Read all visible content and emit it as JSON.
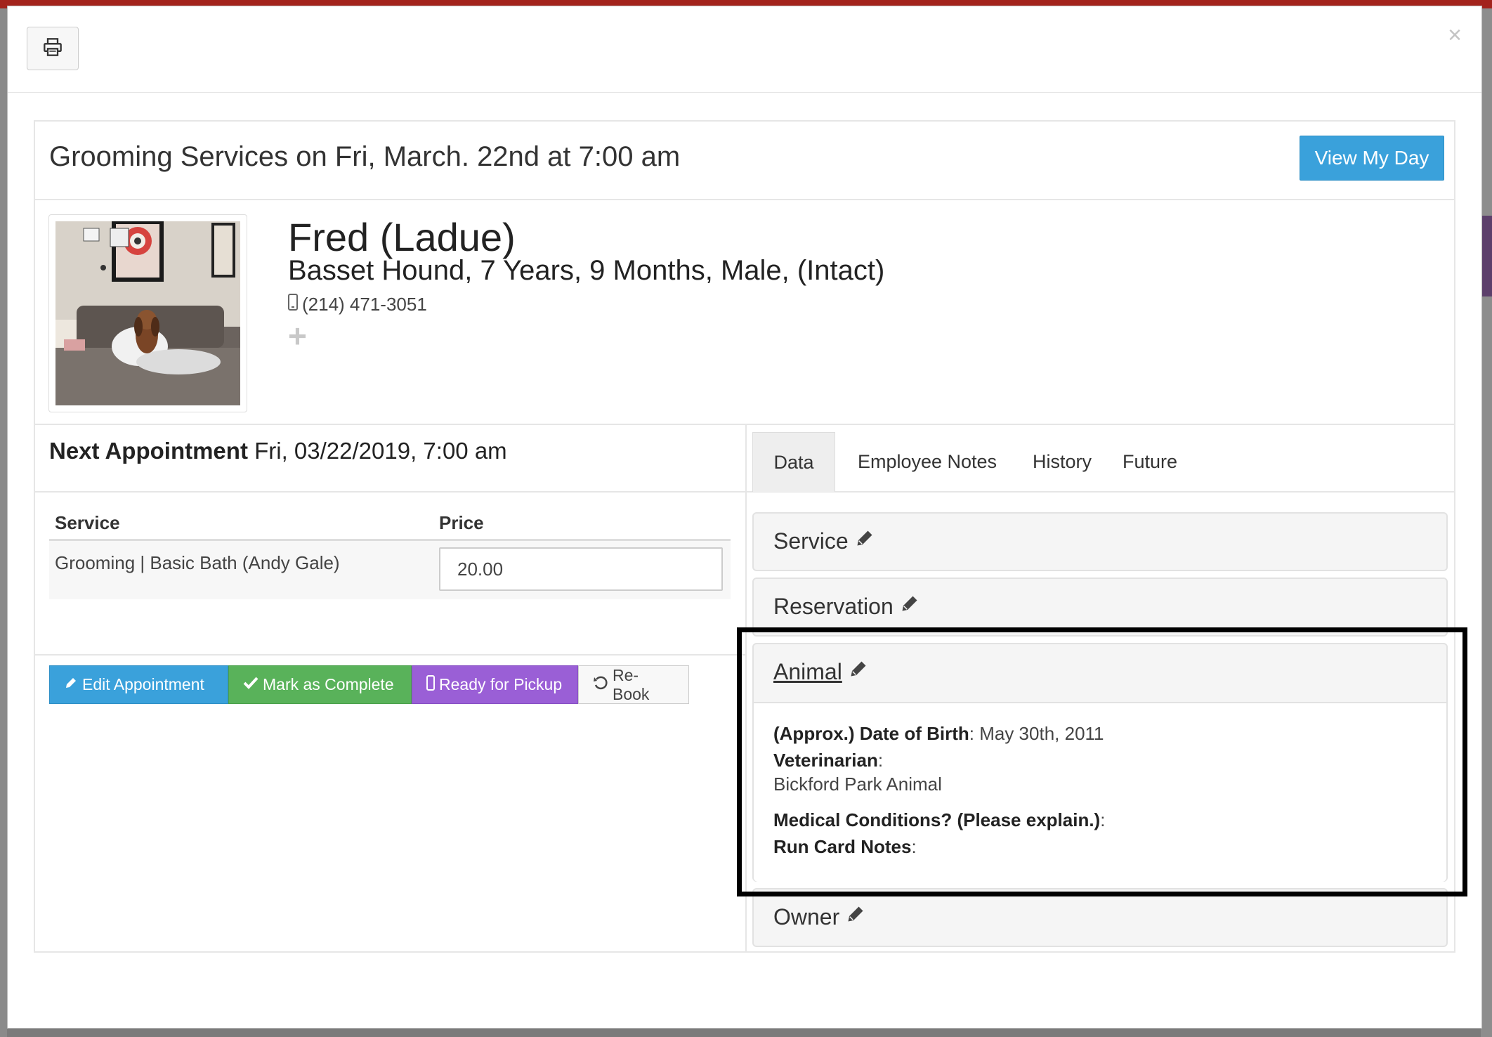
{
  "modal": {
    "close_symbol": "×",
    "print_icon": "printer-icon"
  },
  "header": {
    "title": "Grooming Services on Fri, March. 22nd at 7:00 am",
    "view_day_label": "View My Day"
  },
  "animal": {
    "name": "Fred (Ladue)",
    "description": "Basset Hound, 7 Years, 9 Months, Male, (Intact)",
    "phone": "(214) 471-3051",
    "add_symbol": "+"
  },
  "appointment": {
    "next_label": "Next Appointment",
    "next_value": "Fri, 03/22/2019, 7:00 am",
    "table_headers": {
      "service": "Service",
      "price": "Price"
    },
    "rows": [
      {
        "service": "Grooming | Basic Bath (Andy Gale)",
        "price": "20.00"
      }
    ]
  },
  "actions": {
    "edit": "Edit Appointment",
    "complete": "Mark as Complete",
    "pickup": "Ready for Pickup",
    "rebook": "Re-Book"
  },
  "tabs": [
    "Data",
    "Employee Notes",
    "History",
    "Future"
  ],
  "accordion": {
    "service": "Service",
    "reservation": "Reservation",
    "animal": "Animal",
    "owner": "Owner",
    "animal_fields": {
      "dob_label": "(Approx.) Date of Birth",
      "dob_value": "May 30th, 2011",
      "vet_label": "Veterinarian",
      "vet_value": "Bickford Park Animal",
      "medical_label": "Medical Conditions? (Please explain.)",
      "run_card_label": "Run Card Notes"
    }
  },
  "colors": {
    "primary": "#3aa1db",
    "success": "#59b25a",
    "purple": "#9a5fd6"
  }
}
